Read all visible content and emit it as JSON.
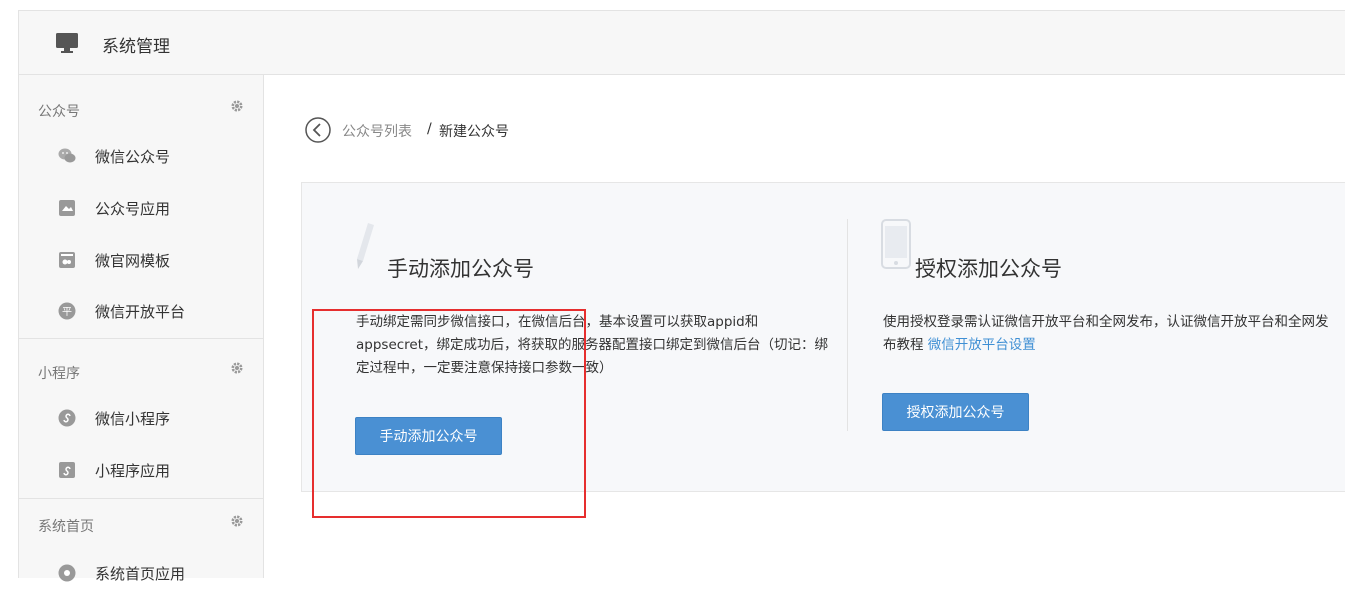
{
  "header": {
    "title": "系统管理",
    "icon": "monitor-icon"
  },
  "sidebar": {
    "groups": [
      {
        "title": "公众号",
        "items": [
          {
            "label": "微信公众号",
            "icon": "wechat-icon"
          },
          {
            "label": "公众号应用",
            "icon": "app-icon"
          },
          {
            "label": "微官网模板",
            "icon": "template-icon"
          },
          {
            "label": "微信开放平台",
            "icon": "platform-icon"
          }
        ]
      },
      {
        "title": "小程序",
        "items": [
          {
            "label": "微信小程序",
            "icon": "mini-program-icon"
          },
          {
            "label": "小程序应用",
            "icon": "mini-app-icon"
          }
        ]
      },
      {
        "title": "系统首页",
        "items": [
          {
            "label": "系统首页应用",
            "icon": "home-app-icon"
          }
        ]
      }
    ]
  },
  "breadcrumb": {
    "link": "公众号列表",
    "separator": "/",
    "current": "新建公众号"
  },
  "manual": {
    "title": "手动添加公众号",
    "description": "手动绑定需同步微信接口，在微信后台，基本设置可以获取appid和appsecret，绑定成功后，将获取的服务器配置接口绑定到微信后台（切记：绑定过程中，一定要注意保持接口参数一致）",
    "button": "手动添加公众号"
  },
  "auth": {
    "title": "授权添加公众号",
    "description": "使用授权登录需认证微信开放平台和全网发布，认证微信开放平台和全网发布教程 ",
    "link": "微信开放平台设置",
    "button": "授权添加公众号"
  },
  "colors": {
    "accent": "#4a90d3",
    "link": "#3f8fd4",
    "highlight": "#e62e2e",
    "sidebar_bg": "#f7f7f7",
    "card_bg": "#f7f8fa"
  }
}
